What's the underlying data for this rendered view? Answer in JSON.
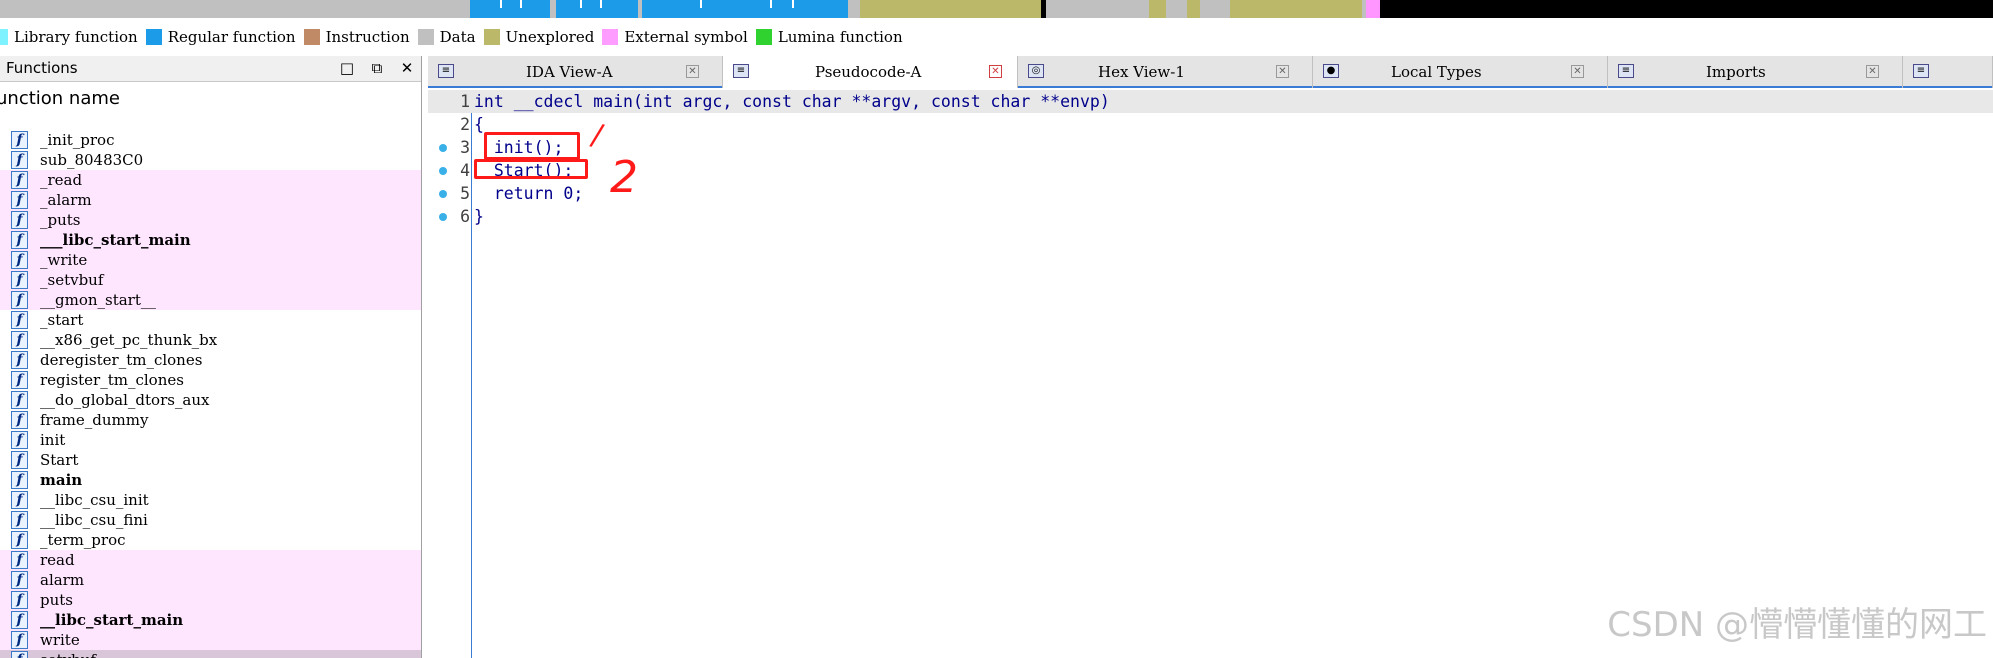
{
  "navband": {
    "colors": {
      "library": "#7ff2ff",
      "regular": "#1c9ce8",
      "data": "#c0c0c0",
      "unexplored": "#bcb86a",
      "external": "#ff96ff",
      "black": "#000000"
    }
  },
  "legend": [
    {
      "label": "Library function",
      "color": "#7ff2ff"
    },
    {
      "label": "Regular function",
      "color": "#1c9ce8"
    },
    {
      "label": "Instruction",
      "color": "#c08a66"
    },
    {
      "label": "Data",
      "color": "#c0c0c0"
    },
    {
      "label": "Unexplored",
      "color": "#bcb86a"
    },
    {
      "label": "External symbol",
      "color": "#ff9cff"
    },
    {
      "label": "Lumina function",
      "color": "#30d230"
    }
  ],
  "functions_panel": {
    "title": "Functions",
    "column_header": "unction name",
    "buttons": {
      "maximize": "□",
      "restore": "⧉",
      "close": "✕"
    },
    "items": [
      {
        "name": "_init_proc",
        "style": "normal"
      },
      {
        "name": "sub_80483C0",
        "style": "normal"
      },
      {
        "name": "_read",
        "style": "ext"
      },
      {
        "name": "_alarm",
        "style": "ext"
      },
      {
        "name": "_puts",
        "style": "ext"
      },
      {
        "name": "___libc_start_main",
        "style": "ext-bold"
      },
      {
        "name": "_write",
        "style": "ext"
      },
      {
        "name": "_setvbuf",
        "style": "ext"
      },
      {
        "name": "__gmon_start__",
        "style": "ext"
      },
      {
        "name": "_start",
        "style": "normal"
      },
      {
        "name": "__x86_get_pc_thunk_bx",
        "style": "normal"
      },
      {
        "name": "deregister_tm_clones",
        "style": "normal"
      },
      {
        "name": "register_tm_clones",
        "style": "normal"
      },
      {
        "name": "__do_global_dtors_aux",
        "style": "normal"
      },
      {
        "name": "frame_dummy",
        "style": "normal"
      },
      {
        "name": "init",
        "style": "normal"
      },
      {
        "name": "Start",
        "style": "normal"
      },
      {
        "name": "main",
        "style": "bold"
      },
      {
        "name": "__libc_csu_init",
        "style": "normal"
      },
      {
        "name": "__libc_csu_fini",
        "style": "normal"
      },
      {
        "name": "_term_proc",
        "style": "normal"
      },
      {
        "name": "read",
        "style": "ext"
      },
      {
        "name": "alarm",
        "style": "ext"
      },
      {
        "name": "puts",
        "style": "ext"
      },
      {
        "name": "__libc_start_main",
        "style": "ext-bold"
      },
      {
        "name": "write",
        "style": "ext"
      },
      {
        "name": "setvbuf",
        "style": "sel"
      }
    ],
    "icon_glyph": "f"
  },
  "tabs": [
    {
      "label": "IDA View-A",
      "icon": "ida-view-icon",
      "active": false
    },
    {
      "label": "Pseudocode-A",
      "icon": "pseudocode-icon",
      "active": true
    },
    {
      "label": "Hex View-1",
      "icon": "hex-view-icon",
      "active": false
    },
    {
      "label": "Local Types",
      "icon": "local-types-icon",
      "active": false
    },
    {
      "label": "Imports",
      "icon": "imports-icon",
      "active": false
    }
  ],
  "tab_close_glyph": "✕",
  "code": {
    "lines": [
      {
        "num": "1",
        "text": "int __cdecl main(int argc, const char **argv, const char **envp)",
        "dot": false
      },
      {
        "num": "2",
        "text": "{",
        "dot": false
      },
      {
        "num": "3",
        "text": "  init();",
        "dot": true
      },
      {
        "num": "4",
        "text": "  Start();",
        "dot": true
      },
      {
        "num": "5",
        "text": "  return 0;",
        "dot": true
      },
      {
        "num": "6",
        "text": "}",
        "dot": true
      }
    ]
  },
  "annotations": {
    "mark1": "/",
    "mark2": "2",
    "color": "#ff1a1a"
  },
  "watermark": "CSDN @懵懵懂懂的网工"
}
